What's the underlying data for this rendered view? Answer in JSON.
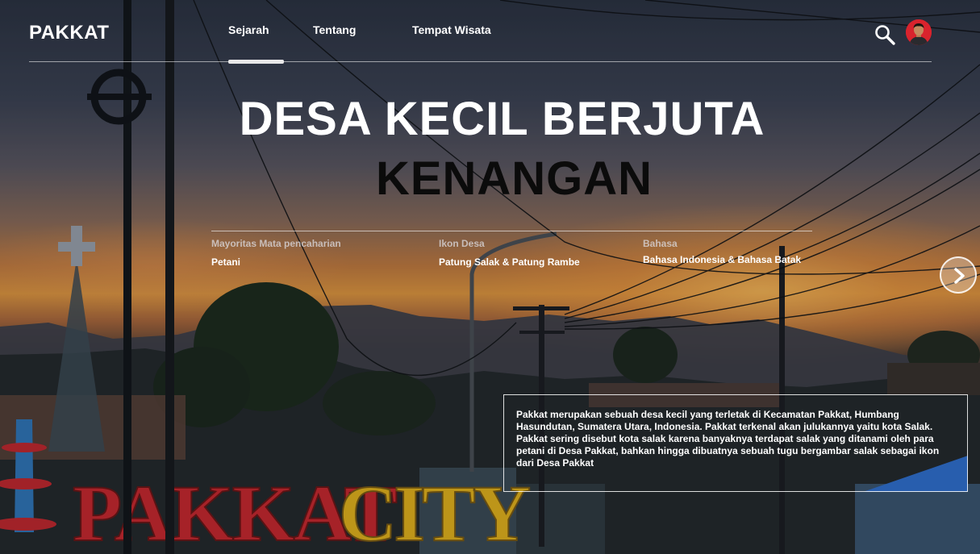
{
  "header": {
    "logo": "PAKKAT",
    "nav": [
      {
        "label": "Sejarah",
        "active": true
      },
      {
        "label": "Tentang",
        "active": false
      },
      {
        "label": "Tempat Wisata",
        "active": false
      }
    ],
    "search_icon": "search-icon",
    "avatar_icon": "user-avatar"
  },
  "hero": {
    "title_line1": "DESA KECIL BERJUTA",
    "title_line2": "KENANGAN",
    "info": [
      {
        "label": "Mayoritas Mata pencaharian",
        "value": "Petani"
      },
      {
        "label": "Ikon Desa",
        "value": "Patung Salak & Patung Rambe"
      },
      {
        "label": "Bahasa",
        "value": "Bahasa Indonesia & Bahasa Batak"
      }
    ],
    "next_icon": "chevron-right-icon",
    "description": "Pakkat merupakan sebuah desa kecil yang terletak di Kecamatan Pakkat, Humbang Hasundutan, Sumatera Utara, Indonesia. Pakkat terkenal akan julukannya yaitu kota Salak. Pakkat sering disebut kota salak karena banyaknya terdapat salak yang ditanami oleh para petani di Desa Pakkat, bahkan hingga dibuatnya sebuah tugu bergambar salak sebagai ikon dari Desa Pakkat",
    "city_sign": "PAKKAT CITY"
  },
  "colors": {
    "accent_red": "#d9232d",
    "title_dark": "#0b0b0b",
    "sign_red": "#c8262c",
    "sign_yellow": "#e4b21a"
  }
}
